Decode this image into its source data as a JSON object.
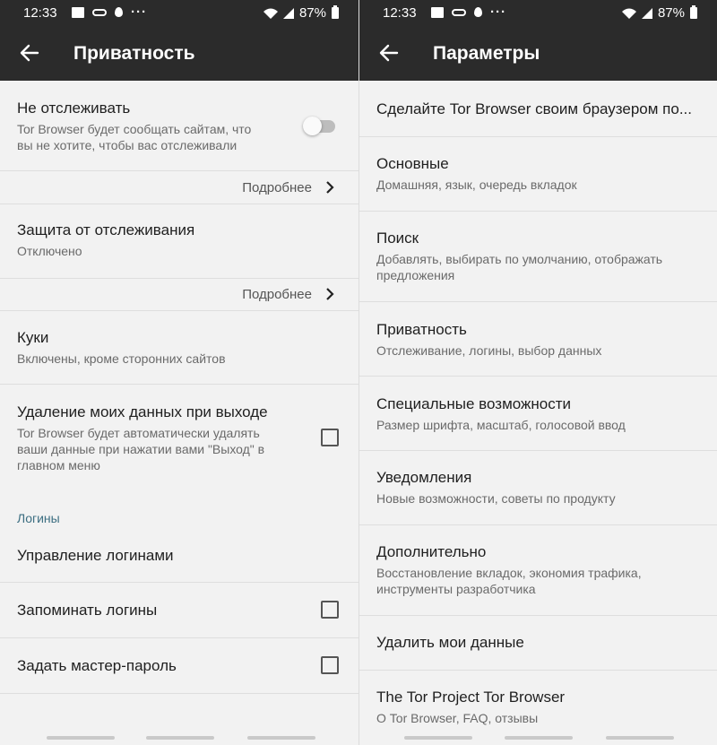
{
  "status_bar": {
    "time": "12:33",
    "battery": "87%"
  },
  "left_screen": {
    "title": "Приватность",
    "dnt": {
      "title": "Не отслеживать",
      "desc_line1": "Tor Browser будет сообщать сайтам, что",
      "desc_line2": "вы не хотите, чтобы вас отслеживали",
      "toggle_on": false
    },
    "learn_more_1": "Подробнее",
    "tracking_protection": {
      "title": "Защита от отслеживания",
      "value": "Отключено"
    },
    "learn_more_2": "Подробнее",
    "cookies": {
      "title": "Куки",
      "value": "Включены, кроме сторонних сайтов"
    },
    "clear_on_exit": {
      "title": "Удаление моих данных при выходе",
      "desc_line1": "Tor Browser будет автоматически удалять",
      "desc_line2": "ваши данные при нажатии вами \"Выход\" в",
      "desc_line3": "главном меню",
      "checked": false
    },
    "logins_section": "Логины",
    "manage_logins": "Управление логинами",
    "remember_logins": {
      "title": "Запоминать логины",
      "checked": false
    },
    "master_password": {
      "title": "Задать мастер-пароль",
      "checked": false
    }
  },
  "right_screen": {
    "title": "Параметры",
    "items": [
      {
        "title": "Сделайте Tor Browser своим браузером по..."
      },
      {
        "title": "Основные",
        "subtitle": "Домашняя, язык, очередь вкладок"
      },
      {
        "title": "Поиск",
        "subtitle_line1": "Добавлять, выбирать по умолчанию, отображать",
        "subtitle_line2": "предложения"
      },
      {
        "title": "Приватность",
        "subtitle": "Отслеживание, логины, выбор данных"
      },
      {
        "title": "Специальные возможности",
        "subtitle": "Размер шрифта, масштаб, голосовой ввод"
      },
      {
        "title": "Уведомления",
        "subtitle": "Новые возможности, советы по продукту"
      },
      {
        "title": "Дополнительно",
        "subtitle_line1": "Восстановление вкладок, экономия трафика,",
        "subtitle_line2": "инструменты разработчика"
      },
      {
        "title": "Удалить мои данные"
      },
      {
        "title": "The Tor Project Tor Browser",
        "subtitle": "О Tor Browser, FAQ, отзывы"
      }
    ]
  },
  "colors": {
    "appbar": "#2b2b2b",
    "background": "#f2f2f2",
    "section_label": "#3d6f82"
  }
}
